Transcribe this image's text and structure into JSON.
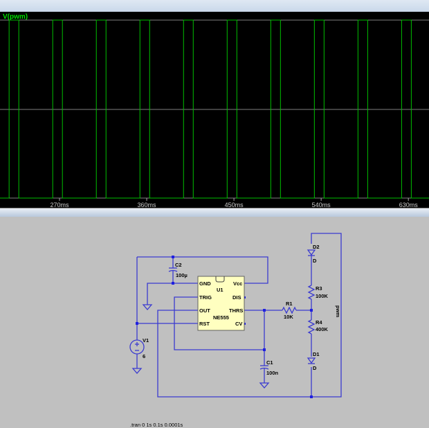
{
  "waveform": {
    "trace_label": "V(pwm)",
    "trace_color": "#00c000",
    "x_ticks": [
      "270ms",
      "360ms",
      "450ms",
      "540ms",
      "630ms"
    ],
    "x_tick_values_ms": [
      270,
      360,
      450,
      540,
      630
    ],
    "view_start_ms": 208.6,
    "ms_per_unit": 0.714,
    "period_ms": 45,
    "pulse_width_ms": 10,
    "first_rise_ms": 218
  },
  "schematic": {
    "wire_color": "#3030d0",
    "ic": {
      "ref": "U1",
      "part": "NE555",
      "pins": {
        "gnd": "GND",
        "vcc": "Vcc",
        "trig": "TRIG",
        "dis": "DIS",
        "out": "OUT",
        "thrs": "THRS",
        "rst": "RST",
        "cv": "CV"
      }
    },
    "c2": {
      "ref": "C2",
      "value": "100µ"
    },
    "c1": {
      "ref": "C1",
      "value": "100n"
    },
    "v1": {
      "ref": "V1",
      "value": "6"
    },
    "r1": {
      "ref": "R1",
      "value": "10K"
    },
    "r3": {
      "ref": "R3",
      "value": "100K"
    },
    "r4": {
      "ref": "R4",
      "value": "400K"
    },
    "d2": {
      "ref": "D2",
      "value": "D"
    },
    "d1": {
      "ref": "D1",
      "value": "D"
    },
    "net_label": "pwm",
    "directive": ".tran 0 1s 0.1s 0.0001s"
  }
}
